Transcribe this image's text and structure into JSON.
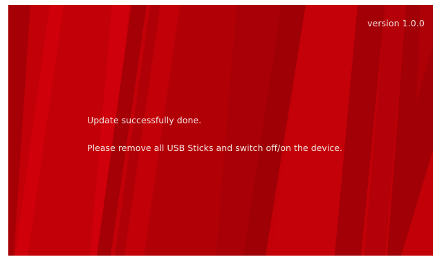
{
  "screen": {
    "version_text": "version 1.0.0",
    "message_line1": "Update successfully done.",
    "message_line2": "Please remove all USB Sticks and switch off/on the device."
  },
  "colors": {
    "background": "#c20008",
    "stripe_dark": "#a00006",
    "stripe_light": "#d4000c",
    "text": "#f4e4e4"
  }
}
